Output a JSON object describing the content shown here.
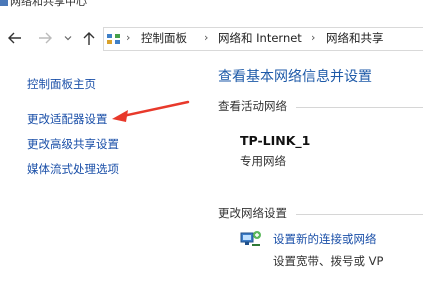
{
  "window": {
    "title": "网络和共享中心"
  },
  "navigation": {
    "back_icon": "arrow-left-icon",
    "forward_icon": "arrow-right-icon",
    "recent_icon": "chevron-down-icon",
    "up_icon": "arrow-up-icon",
    "breadcrumb": [
      "控制面板",
      "网络和 Internet",
      "网络和共享"
    ],
    "separator": "›"
  },
  "sidebar": {
    "items": [
      {
        "label": "控制面板主页"
      },
      {
        "label": "更改适配器设置"
      },
      {
        "label": "更改高级共享设置"
      },
      {
        "label": "媒体流式处理选项"
      }
    ]
  },
  "main": {
    "heading": "查看基本网络信息并设置",
    "active_networks_label": "查看活动网络",
    "network": {
      "name": "TP-LINK_1",
      "type": "专用网络"
    },
    "change_settings_label": "更改网络设置",
    "task": {
      "link": "设置新的连接或网络",
      "description": "设置宽带、拨号或 VP"
    }
  },
  "colors": {
    "link": "#1a4fa8",
    "heading": "#1e5aa8",
    "annotation_arrow": "#e8392b"
  }
}
